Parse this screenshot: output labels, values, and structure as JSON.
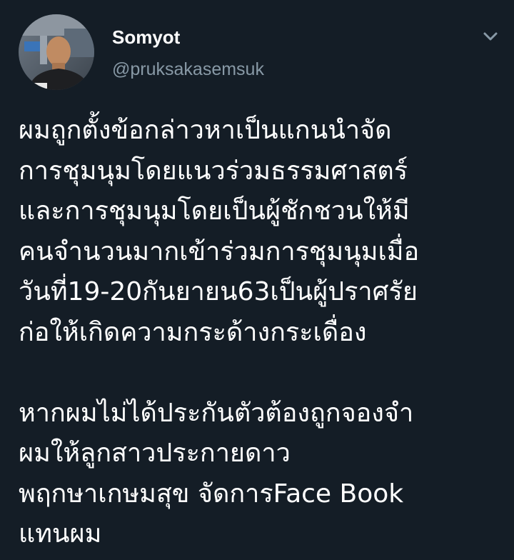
{
  "author": {
    "display_name": "Somyot",
    "handle": "@pruksakasemsuk"
  },
  "icons": {
    "menu": "chevron-down-icon",
    "avatar": "profile-photo"
  },
  "colors": {
    "background": "#141d26",
    "text": "#ffffff",
    "secondary_text": "#8899a6"
  },
  "tweet": {
    "paragraph_1": [
      "ผมถูกตั้งข้อกล่าวหาเป็นแกนนำจัด",
      "การชุมนุมโดยแนวร่วมธรรมศาสตร์",
      "และการชุมนุมโดยเป็นผู้ชักชวนให้มี",
      "คนจำนวนมากเข้าร่วมการชุมนุมเมื่อ",
      "วันที่19-20กันยายน63เป็นผู้ปราศรัย",
      "ก่อให้เกิดความกระด้างกระเดื่อง"
    ],
    "paragraph_2": [
      "หากผมไม่ได้ประกันตัวต้องถูกจองจำ",
      "ผมให้ลูกสาวประกายดาว",
      "พฤกษาเกษมสุข จัดการFace Book",
      "แทนผม"
    ]
  }
}
